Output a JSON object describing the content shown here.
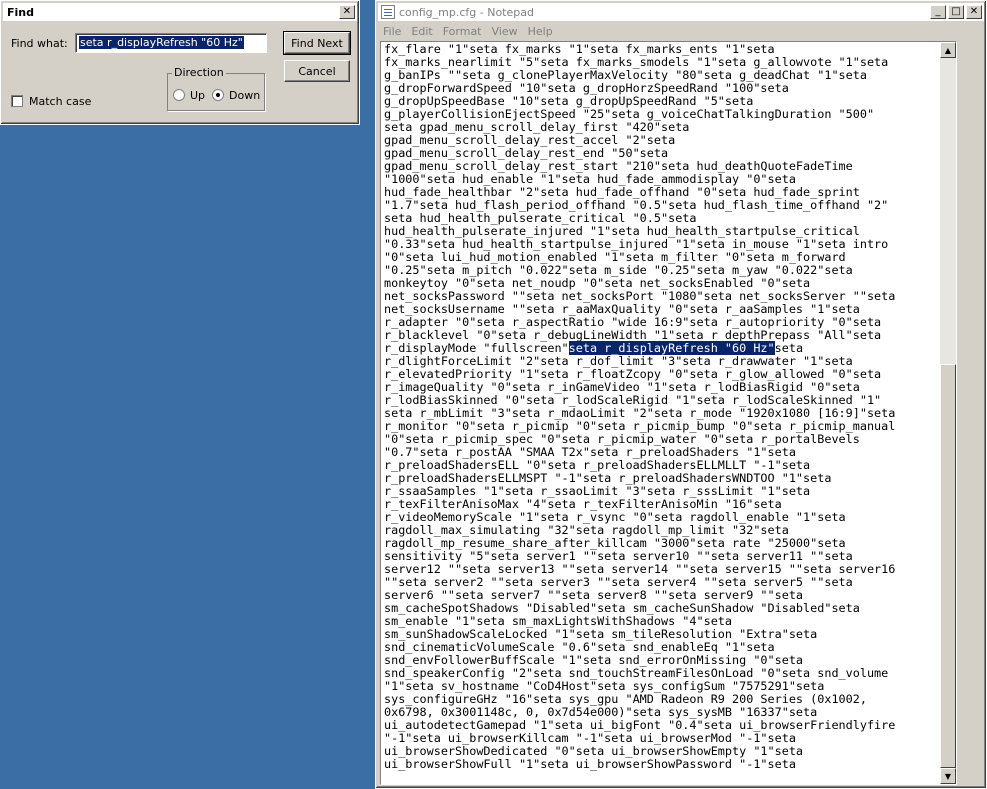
{
  "find_dialog": {
    "title": "Find",
    "find_what_label": "Find what:",
    "find_what_value": "seta r_displayRefresh \"60 Hz\"",
    "find_next_label": "Find Next",
    "cancel_label": "Cancel",
    "direction_label": "Direction",
    "up_label": "Up",
    "down_label": "Down",
    "match_case_label": "Match case",
    "close_glyph": "✕"
  },
  "notepad": {
    "title": "config_mp.cfg - Notepad",
    "menu": [
      "File",
      "Edit",
      "Format",
      "View",
      "Help"
    ],
    "lines": [
      "fx_flare \"1\"seta fx_marks \"1\"seta fx_marks_ents \"1\"seta",
      "fx_marks_nearlimit \"5\"seta fx_marks_smodels \"1\"seta g_allowvote \"1\"seta",
      "g_banIPs \"\"seta g_clonePlayerMaxVelocity \"80\"seta g_deadChat \"1\"seta",
      "g_dropForwardSpeed \"10\"seta g_dropHorzSpeedRand \"100\"seta",
      "g_dropUpSpeedBase \"10\"seta g_dropUpSpeedRand \"5\"seta",
      "g_playerCollisionEjectSpeed \"25\"seta g_voiceChatTalkingDuration \"500\"",
      "seta gpad_menu_scroll_delay_first \"420\"seta",
      "gpad_menu_scroll_delay_rest_accel \"2\"seta",
      "gpad_menu_scroll_delay_rest_end \"50\"seta",
      "gpad_menu_scroll_delay_rest_start \"210\"seta hud_deathQuoteFadeTime",
      "\"1000\"seta hud_enable \"1\"seta hud_fade_ammodisplay \"0\"seta",
      "hud_fade_healthbar \"2\"seta hud_fade_offhand \"0\"seta hud_fade_sprint",
      "\"1.7\"seta hud_flash_period_offhand \"0.5\"seta hud_flash_time_offhand \"2\"",
      "seta hud_health_pulserate_critical \"0.5\"seta",
      "hud_health_pulserate_injured \"1\"seta hud_health_startpulse_critical",
      "\"0.33\"seta hud_health_startpulse_injured \"1\"seta in_mouse \"1\"seta intro",
      "\"0\"seta lui_hud_motion_enabled \"1\"seta m_filter \"0\"seta m_forward",
      "\"0.25\"seta m_pitch \"0.022\"seta m_side \"0.25\"seta m_yaw \"0.022\"seta",
      "monkeytoy \"0\"seta net_noudp \"0\"seta net_socksEnabled \"0\"seta",
      "net_socksPassword \"\"seta net_socksPort \"1080\"seta net_socksServer \"\"seta",
      "net_socksUsername \"\"seta r_aaMaxQuality \"0\"seta r_aaSamples \"1\"seta",
      "r_adapter \"0\"seta r_aspectRatio \"wide 16:9\"seta r_autopriority \"0\"seta",
      "r_blacklevel \"0\"seta r_debugLineWidth \"1\"seta r_depthPrepass \"All\"seta",
      "r_dlightForceLimit \"2\"seta r_dof_limit \"3\"seta r_drawwater \"1\"seta",
      "r_elevatedPriority \"1\"seta r_floatZcopy \"0\"seta r_glow_allowed \"0\"seta",
      "r_imageQuality \"0\"seta r_inGameVideo \"1\"seta r_lodBiasRigid \"0\"seta",
      "r_lodBiasSkinned \"0\"seta r_lodScaleRigid \"1\"seta r_lodScaleSkinned \"1\"",
      "seta r_mbLimit \"3\"seta r_mdaoLimit \"2\"seta r_mode \"1920x1080 [16:9]\"seta",
      "r_monitor \"0\"seta r_picmip \"0\"seta r_picmip_bump \"0\"seta r_picmip_manual",
      "\"0\"seta r_picmip_spec \"0\"seta r_picmip_water \"0\"seta r_portalBevels",
      "\"0.7\"seta r_postAA \"SMAA T2x\"seta r_preloadShaders \"1\"seta",
      "r_preloadShadersELL \"0\"seta r_preloadShadersELLMLLT \"-1\"seta",
      "r_preloadShadersELLMSPT \"-1\"seta r_preloadShadersWNDTOO \"1\"seta",
      "r_ssaaSamples \"1\"seta r_ssaoLimit \"3\"seta r_sssLimit \"1\"seta",
      "r_texFilterAnisoMax \"4\"seta r_texFilterAnisoMin \"16\"seta",
      "r_videoMemoryScale \"1\"seta r_vsync \"0\"seta ragdoll_enable \"1\"seta",
      "ragdoll_max_simulating \"32\"seta ragdoll_mp_limit \"32\"seta",
      "ragdoll_mp_resume_share_after_killcam \"3000\"seta rate \"25000\"seta",
      "sensitivity \"5\"seta server1 \"\"seta server10 \"\"seta server11 \"\"seta",
      "server12 \"\"seta server13 \"\"seta server14 \"\"seta server15 \"\"seta server16",
      "\"\"seta server2 \"\"seta server3 \"\"seta server4 \"\"seta server5 \"\"seta",
      "server6 \"\"seta server7 \"\"seta server8 \"\"seta server9 \"\"seta",
      "sm_cacheSpotShadows \"Disabled\"seta sm_cacheSunShadow \"Disabled\"seta",
      "sm_enable \"1\"seta sm_maxLightsWithShadows \"4\"seta",
      "sm_sunShadowScaleLocked \"1\"seta sm_tileResolution \"Extra\"seta",
      "snd_cinematicVolumeScale \"0.6\"seta snd_enableEq \"1\"seta",
      "snd_envFollowerBuffScale \"1\"seta snd_errorOnMissing \"0\"seta",
      "snd_speakerConfig \"2\"seta snd_touchStreamFilesOnLoad \"0\"seta snd_volume",
      "\"1\"seta sv_hostname \"CoD4Host\"seta sys_configSum \"7575291\"seta",
      "sys_configureGHz \"16\"seta sys_gpu \"AMD Radeon R9 200 Series (0x1002,",
      "0x6798, 0x3001148c, 0, 0x7d54e000)\"seta sys_sysMB \"16337\"seta",
      "ui_autodetectGamepad \"1\"seta ui_bigFont \"0.4\"seta ui_browserFriendlyfire",
      "\"-1\"seta ui_browserKillcam \"-1\"seta ui_browserMod \"-1\"seta",
      "ui_browserShowDedicated \"0\"seta ui_browserShowEmpty \"1\"seta",
      "ui_browserShowFull \"1\"seta ui_browserShowPassword \"-1\"seta"
    ],
    "highlight_line": {
      "before": "r_displayMode \"fullscreen\"",
      "match": "seta r_displayRefresh \"60 Hz\"",
      "after": "seta"
    }
  }
}
